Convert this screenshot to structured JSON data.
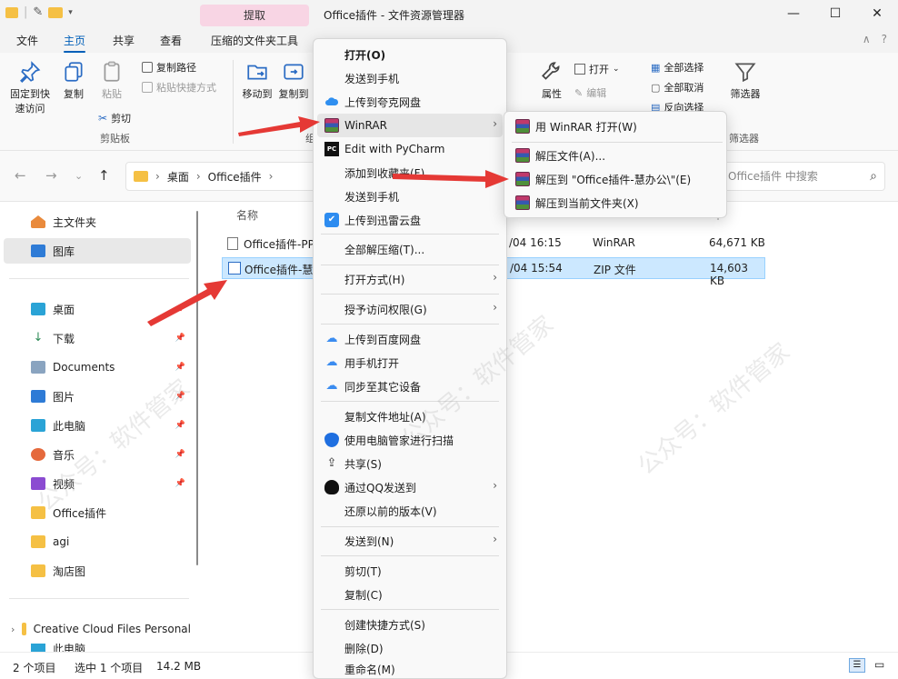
{
  "titlebar": {
    "title": "Office插件 - 文件资源管理器",
    "context_tab": "提取",
    "minimize_icon": "minimize-icon",
    "maximize_icon": "maximize-icon",
    "close_icon": "close-icon"
  },
  "ribbon_tabs": [
    "文件",
    "主页",
    "共享",
    "查看",
    "压缩的文件夹工具"
  ],
  "active_tab": "主页",
  "ribbon": {
    "clipboard": {
      "pin_label": "固定到快速访问",
      "copy_label": "复制",
      "paste_label": "粘贴",
      "copy_path_label": "复制路径",
      "paste_shortcut_label": "粘贴快捷方式",
      "cut_label": "剪切",
      "group_label": "剪贴板"
    },
    "organize": {
      "move_label": "移动到",
      "copy_to_label": "复制到",
      "group_label": "组"
    },
    "open": {
      "open_label": "打开",
      "edit_label": "编辑",
      "properties_label": "属性"
    },
    "select": {
      "select_all_label": "全部选择",
      "select_none_label": "全部取消",
      "invert_label": "反向选择"
    },
    "filter": {
      "filter_label": "筛选器",
      "group_label": "筛选器"
    }
  },
  "address": {
    "crumbs": [
      "桌面",
      "Office插件"
    ],
    "search_placeholder": "Office插件 中搜索"
  },
  "sidebar": {
    "home": "主文件夹",
    "gallery": "图库",
    "pinned": [
      "桌面",
      "下载",
      "Documents",
      "图片",
      "此电脑",
      "音乐",
      "视频"
    ],
    "folders": [
      "Office插件",
      "agi",
      "淘店图"
    ],
    "cloud": "Creative Cloud Files Personal",
    "more": "此电脑"
  },
  "files": {
    "column_name": "名称",
    "rows": [
      {
        "name": "Office插件-PPT",
        "date": "/04 16:15",
        "type": "WinRAR",
        "size": "64,671 KB"
      },
      {
        "name": "Office插件-慧",
        "date": "/04 15:54",
        "type": "ZIP 文件",
        "size": "14,603 KB"
      }
    ]
  },
  "status": {
    "count": "2 个项目",
    "selected": "选中 1 个项目",
    "size": "14.2 MB"
  },
  "context_menu": {
    "items": [
      "打开(O)",
      "发送到手机",
      "上传到夸克网盘",
      "WinRAR",
      "Edit with PyCharm",
      "添加到收藏夹(F)",
      "发送到手机",
      "上传到迅雷云盘",
      "全部解压缩(T)...",
      "打开方式(H)",
      "授予访问权限(G)",
      "上传到百度网盘",
      "用手机打开",
      "同步至其它设备",
      "复制文件地址(A)",
      "使用电脑管家进行扫描",
      "共享(S)",
      "通过QQ发送到",
      "还原以前的版本(V)",
      "发送到(N)",
      "剪切(T)",
      "复制(C)",
      "创建快捷方式(S)",
      "删除(D)",
      "重命名(M)"
    ]
  },
  "winrar_submenu": {
    "items": [
      "用 WinRAR 打开(W)",
      "解压文件(A)...",
      "解压到 \"Office插件-慧办公\\\"(E)",
      "解压到当前文件夹(X)"
    ]
  },
  "watermark": "公众号：软件管家",
  "colors": {
    "accent": "#005fb8",
    "selection": "#cce8ff",
    "arrow": "#e53935",
    "context_tab": "#f8d5e4"
  }
}
